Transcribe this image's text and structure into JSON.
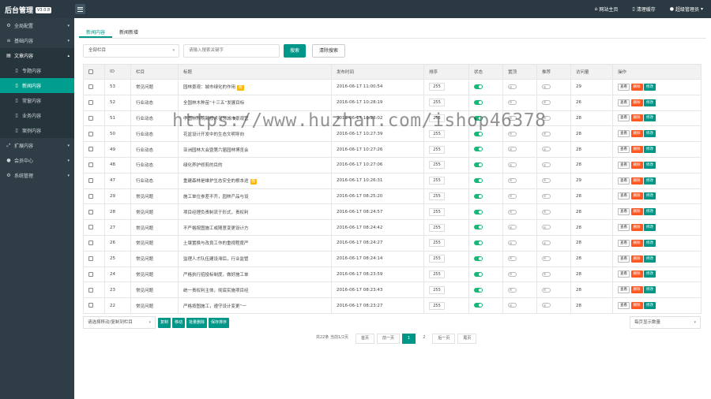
{
  "app": {
    "title": "后台管理",
    "version": "V3.0.8"
  },
  "topnav": {
    "site_home": "网站主页",
    "clear_cache": "清理缓存",
    "admin": "超级管理员"
  },
  "sidebar": {
    "items": [
      {
        "label": "全局配置",
        "icon": "gear-icon"
      },
      {
        "label": "基础内容",
        "icon": "list-icon"
      },
      {
        "label": "文章内容",
        "icon": "document-icon"
      }
    ],
    "subitems": [
      {
        "label": "专题内容"
      },
      {
        "label": "新闻内容"
      },
      {
        "label": "常窗内容"
      },
      {
        "label": "业务内容"
      },
      {
        "label": "案例内容"
      }
    ],
    "items_after": [
      {
        "label": "扩展内容"
      },
      {
        "label": "会员中心"
      },
      {
        "label": "系统管理"
      }
    ]
  },
  "tabs": [
    "新闻内容",
    "新闻新增"
  ],
  "filter": {
    "category_select": "全部栏目",
    "search_placeholder": "请输入搜索关键字",
    "search_button": "搜索",
    "clear_button": "清除搜索"
  },
  "table": {
    "headers": [
      "",
      "ID",
      "栏目",
      "标题",
      "发布时间",
      "排序",
      "状态",
      "置顶",
      "推荐",
      "访问量",
      "操作"
    ],
    "rows": [
      {
        "id": "53",
        "category": "常见问题",
        "title": "园林景观：城市绿化的作用",
        "badge": "图",
        "time": "2016-06-17 11:00:54",
        "sort": "255",
        "status": true,
        "top": false,
        "rec": false,
        "views": "29"
      },
      {
        "id": "52",
        "category": "行业动态",
        "title": "全国林木种苗“十三五”发展目标",
        "badge": "",
        "time": "2016-06-17 10:28:19",
        "sort": "255",
        "status": true,
        "top": false,
        "rec": false,
        "views": "26"
      },
      {
        "id": "51",
        "category": "行业动态",
        "title": "中国林科院新技术引领城市景观营",
        "badge": "",
        "time": "2016-06-17 10:28:02",
        "sort": "255",
        "status": true,
        "top": false,
        "rec": false,
        "views": "28"
      },
      {
        "id": "50",
        "category": "行业动态",
        "title": "花盆设计开发中的生态文明导向",
        "badge": "",
        "time": "2016-06-17 10:27:39",
        "sort": "255",
        "status": true,
        "top": false,
        "rec": false,
        "views": "28"
      },
      {
        "id": "49",
        "category": "行业动态",
        "title": "亚洲园林大会暨第六届园林博览会",
        "badge": "",
        "time": "2016-06-17 10:27:26",
        "sort": "255",
        "status": true,
        "top": false,
        "rec": false,
        "views": "28"
      },
      {
        "id": "48",
        "category": "行业动态",
        "title": "绿化养护修剪的目的",
        "badge": "",
        "time": "2016-06-17 10:27:06",
        "sort": "255",
        "status": true,
        "top": false,
        "rec": false,
        "views": "28"
      },
      {
        "id": "47",
        "category": "行业动态",
        "title": "重建森林是维护生态安全的根本途",
        "badge": "图",
        "time": "2016-06-17 10:26:31",
        "sort": "255",
        "status": true,
        "top": false,
        "rec": false,
        "views": "29"
      },
      {
        "id": "29",
        "category": "常见问题",
        "title": "施工单位参差不齐，园林产品与设",
        "badge": "",
        "time": "2016-06-17 08:25:20",
        "sort": "255",
        "status": true,
        "top": false,
        "rec": false,
        "views": "28"
      },
      {
        "id": "28",
        "category": "常见问题",
        "title": "项目经理负责制流于形式，责权利",
        "badge": "",
        "time": "2016-06-17 08:24:57",
        "sort": "255",
        "status": true,
        "top": false,
        "rec": false,
        "views": "28"
      },
      {
        "id": "27",
        "category": "常见问题",
        "title": "不严格按图施工或随意变更设计方",
        "badge": "",
        "time": "2016-06-17 08:24:42",
        "sort": "255",
        "status": true,
        "top": false,
        "rec": false,
        "views": "28"
      },
      {
        "id": "26",
        "category": "常见问题",
        "title": "土壤置换与改良工作的重视程度严",
        "badge": "",
        "time": "2016-06-17 08:24:27",
        "sort": "255",
        "status": true,
        "top": false,
        "rec": false,
        "views": "28"
      },
      {
        "id": "25",
        "category": "常见问题",
        "title": "监理人才队伍建设滞后，行业监管",
        "badge": "",
        "time": "2016-06-17 08:24:14",
        "sort": "255",
        "status": true,
        "top": false,
        "rec": false,
        "views": "28"
      },
      {
        "id": "24",
        "category": "常见问题",
        "title": "严格执行招投标制度，做好施工单",
        "badge": "",
        "time": "2016-06-17 08:23:59",
        "sort": "255",
        "status": true,
        "top": false,
        "rec": false,
        "views": "28"
      },
      {
        "id": "23",
        "category": "常见问题",
        "title": "统一责权利主体，彻底实施项目经",
        "badge": "",
        "time": "2016-06-17 08:23:43",
        "sort": "255",
        "status": true,
        "top": false,
        "rec": false,
        "views": "28"
      },
      {
        "id": "22",
        "category": "常见问题",
        "title": "严格按图施工，遵守设计变更“一",
        "badge": "",
        "time": "2016-06-17 08:23:27",
        "sort": "255",
        "status": true,
        "top": false,
        "rec": false,
        "views": "28"
      }
    ],
    "ops": {
      "view": "查看",
      "delete": "删除",
      "edit": "修改"
    }
  },
  "bottom": {
    "move_select": "请选择移动/复制到栏目",
    "copy": "复制",
    "move": "移动",
    "batch_delete": "批量删除",
    "save_sort": "保存排序",
    "per_page": "每页显示数量"
  },
  "pager": {
    "summary": "共22条 当前1/2页",
    "first": "首页",
    "prev": "前一页",
    "pages": [
      "1",
      "2"
    ],
    "next": "后一页",
    "last": "尾页"
  },
  "watermark": "https://www.huzhan.com/ishop46378",
  "colors": {
    "accent": "#009688",
    "danger": "#ff5722",
    "warning": "#ffb800",
    "topbar": "#2b3a42",
    "sidebar": "#2f3e46"
  }
}
